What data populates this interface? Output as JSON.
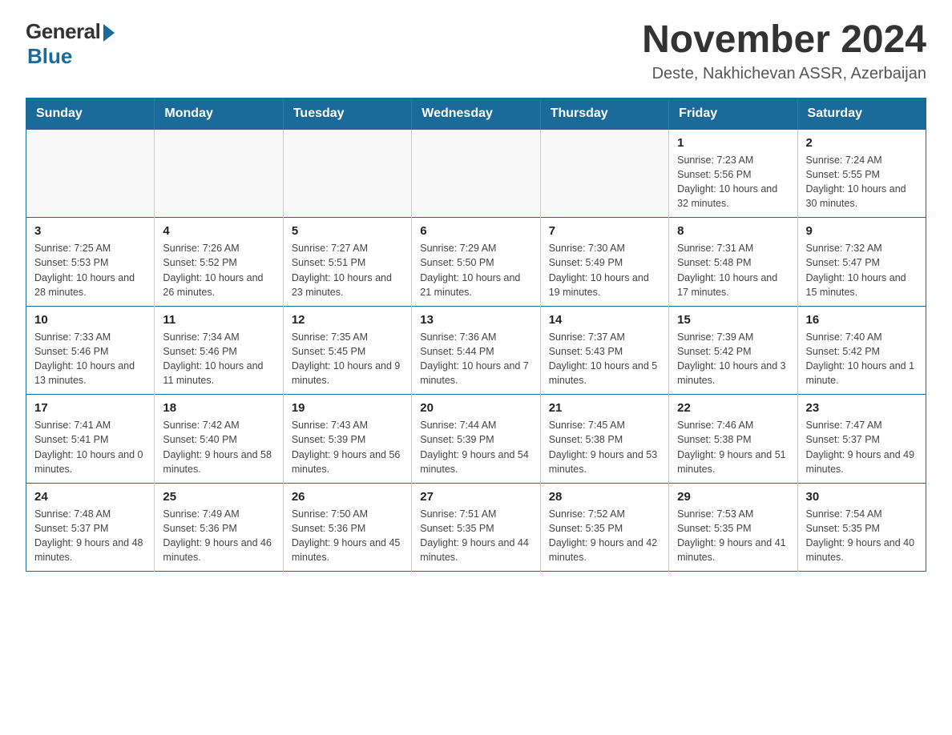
{
  "header": {
    "logo_general": "General",
    "logo_blue": "Blue",
    "month_title": "November 2024",
    "location": "Deste, Nakhichevan ASSR, Azerbaijan"
  },
  "weekdays": [
    "Sunday",
    "Monday",
    "Tuesday",
    "Wednesday",
    "Thursday",
    "Friday",
    "Saturday"
  ],
  "weeks": [
    [
      {
        "day": "",
        "info": ""
      },
      {
        "day": "",
        "info": ""
      },
      {
        "day": "",
        "info": ""
      },
      {
        "day": "",
        "info": ""
      },
      {
        "day": "",
        "info": ""
      },
      {
        "day": "1",
        "info": "Sunrise: 7:23 AM\nSunset: 5:56 PM\nDaylight: 10 hours and 32 minutes."
      },
      {
        "day": "2",
        "info": "Sunrise: 7:24 AM\nSunset: 5:55 PM\nDaylight: 10 hours and 30 minutes."
      }
    ],
    [
      {
        "day": "3",
        "info": "Sunrise: 7:25 AM\nSunset: 5:53 PM\nDaylight: 10 hours and 28 minutes."
      },
      {
        "day": "4",
        "info": "Sunrise: 7:26 AM\nSunset: 5:52 PM\nDaylight: 10 hours and 26 minutes."
      },
      {
        "day": "5",
        "info": "Sunrise: 7:27 AM\nSunset: 5:51 PM\nDaylight: 10 hours and 23 minutes."
      },
      {
        "day": "6",
        "info": "Sunrise: 7:29 AM\nSunset: 5:50 PM\nDaylight: 10 hours and 21 minutes."
      },
      {
        "day": "7",
        "info": "Sunrise: 7:30 AM\nSunset: 5:49 PM\nDaylight: 10 hours and 19 minutes."
      },
      {
        "day": "8",
        "info": "Sunrise: 7:31 AM\nSunset: 5:48 PM\nDaylight: 10 hours and 17 minutes."
      },
      {
        "day": "9",
        "info": "Sunrise: 7:32 AM\nSunset: 5:47 PM\nDaylight: 10 hours and 15 minutes."
      }
    ],
    [
      {
        "day": "10",
        "info": "Sunrise: 7:33 AM\nSunset: 5:46 PM\nDaylight: 10 hours and 13 minutes."
      },
      {
        "day": "11",
        "info": "Sunrise: 7:34 AM\nSunset: 5:46 PM\nDaylight: 10 hours and 11 minutes."
      },
      {
        "day": "12",
        "info": "Sunrise: 7:35 AM\nSunset: 5:45 PM\nDaylight: 10 hours and 9 minutes."
      },
      {
        "day": "13",
        "info": "Sunrise: 7:36 AM\nSunset: 5:44 PM\nDaylight: 10 hours and 7 minutes."
      },
      {
        "day": "14",
        "info": "Sunrise: 7:37 AM\nSunset: 5:43 PM\nDaylight: 10 hours and 5 minutes."
      },
      {
        "day": "15",
        "info": "Sunrise: 7:39 AM\nSunset: 5:42 PM\nDaylight: 10 hours and 3 minutes."
      },
      {
        "day": "16",
        "info": "Sunrise: 7:40 AM\nSunset: 5:42 PM\nDaylight: 10 hours and 1 minute."
      }
    ],
    [
      {
        "day": "17",
        "info": "Sunrise: 7:41 AM\nSunset: 5:41 PM\nDaylight: 10 hours and 0 minutes."
      },
      {
        "day": "18",
        "info": "Sunrise: 7:42 AM\nSunset: 5:40 PM\nDaylight: 9 hours and 58 minutes."
      },
      {
        "day": "19",
        "info": "Sunrise: 7:43 AM\nSunset: 5:39 PM\nDaylight: 9 hours and 56 minutes."
      },
      {
        "day": "20",
        "info": "Sunrise: 7:44 AM\nSunset: 5:39 PM\nDaylight: 9 hours and 54 minutes."
      },
      {
        "day": "21",
        "info": "Sunrise: 7:45 AM\nSunset: 5:38 PM\nDaylight: 9 hours and 53 minutes."
      },
      {
        "day": "22",
        "info": "Sunrise: 7:46 AM\nSunset: 5:38 PM\nDaylight: 9 hours and 51 minutes."
      },
      {
        "day": "23",
        "info": "Sunrise: 7:47 AM\nSunset: 5:37 PM\nDaylight: 9 hours and 49 minutes."
      }
    ],
    [
      {
        "day": "24",
        "info": "Sunrise: 7:48 AM\nSunset: 5:37 PM\nDaylight: 9 hours and 48 minutes."
      },
      {
        "day": "25",
        "info": "Sunrise: 7:49 AM\nSunset: 5:36 PM\nDaylight: 9 hours and 46 minutes."
      },
      {
        "day": "26",
        "info": "Sunrise: 7:50 AM\nSunset: 5:36 PM\nDaylight: 9 hours and 45 minutes."
      },
      {
        "day": "27",
        "info": "Sunrise: 7:51 AM\nSunset: 5:35 PM\nDaylight: 9 hours and 44 minutes."
      },
      {
        "day": "28",
        "info": "Sunrise: 7:52 AM\nSunset: 5:35 PM\nDaylight: 9 hours and 42 minutes."
      },
      {
        "day": "29",
        "info": "Sunrise: 7:53 AM\nSunset: 5:35 PM\nDaylight: 9 hours and 41 minutes."
      },
      {
        "day": "30",
        "info": "Sunrise: 7:54 AM\nSunset: 5:35 PM\nDaylight: 9 hours and 40 minutes."
      }
    ]
  ]
}
